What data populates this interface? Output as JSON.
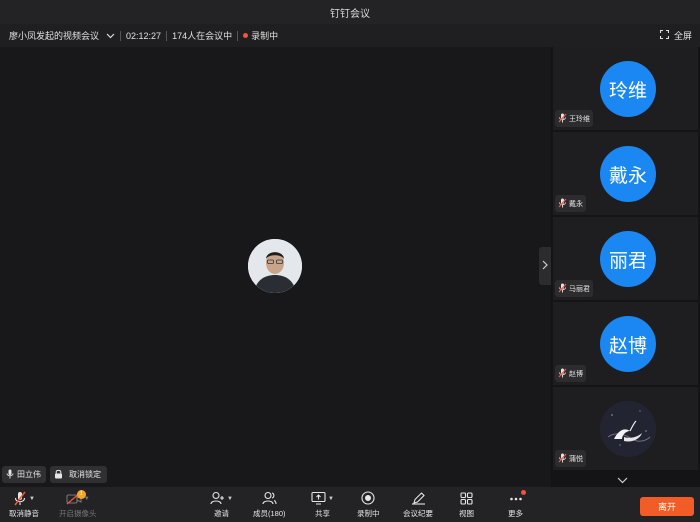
{
  "app": {
    "window_title": "钉钉会议"
  },
  "info_bar": {
    "meeting_name": "廖小凤发起的视频会议",
    "duration": "02:12:27",
    "attendee_count": "174人在会议中",
    "recording_status": "录制中",
    "fullscreen_label": "全屏"
  },
  "stage": {
    "speaker_tag": "田立伟",
    "unlock_label": "取消锁定"
  },
  "participants": [
    {
      "avatar_text": "玲维",
      "name": "王玲维",
      "avatar_color": "#1b87f2"
    },
    {
      "avatar_text": "戴永",
      "name": "戴永",
      "avatar_color": "#1b87f2"
    },
    {
      "avatar_text": "丽君",
      "name": "马丽君",
      "avatar_color": "#1b87f2"
    },
    {
      "avatar_text": "赵博",
      "name": "赵博",
      "avatar_color": "#1b87f2"
    },
    {
      "avatar_text": "",
      "name": "蒲悦",
      "avatar_color": "#24242e"
    }
  ],
  "toolbar": {
    "unmute_label": "取消静音",
    "camera_label": "开启摄像头",
    "camera_badge": "!",
    "invite_label": "邀请",
    "members_label": "成员(180)",
    "share_label": "共享",
    "recording_label": "录制中",
    "minutes_label": "会议纪要",
    "view_label": "视图",
    "more_label": "更多",
    "leave_label": "离开"
  },
  "colors": {
    "accent": "#1b87f2",
    "leave": "#f25c26",
    "record": "#f5533d",
    "warning": "#f5a623"
  }
}
